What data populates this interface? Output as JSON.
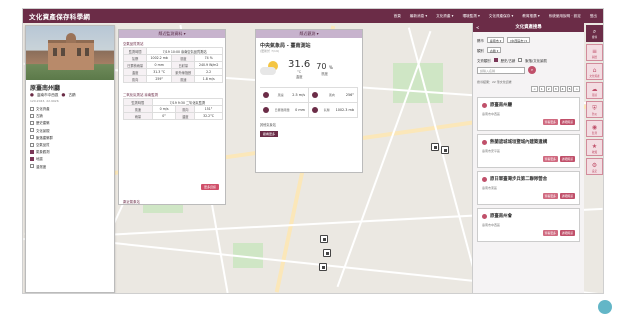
{
  "app": {
    "title": "文化資產保存科學網",
    "nav": [
      "首頁",
      "最新消息 ▾",
      "文化資產 ▾",
      "環境監測 ▾",
      "文化資產保存 ▾",
      "教育推廣 ▾",
      "系統使用說明 · 設定",
      "登出"
    ]
  },
  "poi": {
    "title": "原臺南州廳",
    "city": "臺南市中西區",
    "tag": "古蹟",
    "coords": "120.2043, 22.9926",
    "layers": [
      {
        "label": "文化資產",
        "checked": false
      },
      {
        "label": "古蹟",
        "checked": false
      },
      {
        "label": "歷史建築",
        "checked": false
      },
      {
        "label": "文化景觀",
        "checked": false
      },
      {
        "label": "聚落建築群",
        "checked": false
      },
      {
        "label": "空氣品質",
        "checked": false
      },
      {
        "label": "氣象觀測",
        "checked": true
      },
      {
        "label": "地震",
        "checked": true
      },
      {
        "label": "溫濕度",
        "checked": false
      }
    ]
  },
  "pollution": {
    "header": "鄰近監測資料 ▾",
    "section1": "空氣品質測站",
    "t1_rows": [
      [
        "監測時間",
        "7/19 10:00 臺南空氣品質測站",
        "",
        ""
      ],
      [
        "氣壓",
        "1002.2 mb",
        "濕度",
        "74 %"
      ],
      [
        "日累積雨量",
        "0 mm",
        "日射量",
        "240.9 W/m2"
      ],
      [
        "溫度",
        "31.3 °C",
        "紫外線指數",
        "2.2"
      ],
      [
        "風向",
        "259°",
        "風速",
        "1.8 m/s"
      ]
    ],
    "section2": "二氧化氮測站 臺南監測",
    "t2_rows": [
      [
        "監測時間",
        "7/19 9:30 二氧化氮監測",
        "",
        ""
      ],
      [
        "風速",
        "0 m/s",
        "風向",
        "151°"
      ],
      [
        "雨量",
        "0°",
        "溫度",
        "32.2°C"
      ]
    ],
    "more_button": "更多資訊",
    "section3": "鄰近氣象站"
  },
  "station": {
    "header": "鄰近觀測 ▾",
    "name": "中央氣象局 - 臺南測站",
    "time": "(更新於 7/19)",
    "temp": "31.6",
    "temp_unit": "°C",
    "temp_label": "溫度",
    "humidity": "70",
    "humidity_unit": "%",
    "humidity_label": "濕度",
    "metrics": [
      {
        "label": "風速",
        "value": "2.5 m/s"
      },
      {
        "label": "風向",
        "value": "256°"
      },
      {
        "label": "日累積雨量",
        "value": "0 mm"
      },
      {
        "label": "氣壓",
        "value": "1002.3 mb"
      }
    ],
    "footer_text": "其他氣象站",
    "footer_button": "觀看更多"
  },
  "search": {
    "title": "文化資產搜尋",
    "back": "<",
    "county_label": "縣市",
    "county_value": "臺南市 ▾",
    "district_value": "[中西區市] ▾",
    "category_label": "類別",
    "category_value": "古蹟 ▾",
    "option_label": "文資類別",
    "option_a": "歷史/古蹟",
    "option_b": "聚落/文化景觀",
    "search_placeholder": "請輸入名稱",
    "results": "搜尋結果：22 筆文化資產",
    "pages": [
      "<",
      "1",
      "2",
      "3",
      "4",
      "5",
      ">"
    ],
    "cards": [
      {
        "title": "原臺南州廳",
        "sub": "臺南市中西區",
        "b1": "查看更多",
        "b2": "詳細資訊"
      },
      {
        "title": "熱蘭遮城城垣暨城內建築遺構",
        "sub": "臺南市安平區",
        "b1": "查看更多",
        "b2": "詳細資訊"
      },
      {
        "title": "原日軍臺灣步兵第二聯隊營舍",
        "sub": "臺南市東區",
        "b1": "查看更多",
        "b2": "詳細資訊"
      },
      {
        "title": "原臺南州會",
        "sub": "臺南市中西區",
        "b1": "查看更多",
        "b2": "詳細資訊"
      }
    ]
  },
  "strip": [
    {
      "label": "搜尋",
      "icon": "search-icon"
    },
    {
      "label": "圖層",
      "icon": "layers-icon"
    },
    {
      "label": "文化資產",
      "icon": "heritage-icon"
    },
    {
      "label": "環境",
      "icon": "environment-icon"
    },
    {
      "label": "防災",
      "icon": "shield-icon"
    },
    {
      "label": "監測",
      "icon": "monitor-icon"
    },
    {
      "label": "收藏",
      "icon": "bookmark-icon"
    },
    {
      "label": "設定",
      "icon": "gear-icon"
    }
  ],
  "colors": {
    "brand": "#6b2c47",
    "accent": "#c0506a",
    "panel_header": "#c7b3cd"
  }
}
